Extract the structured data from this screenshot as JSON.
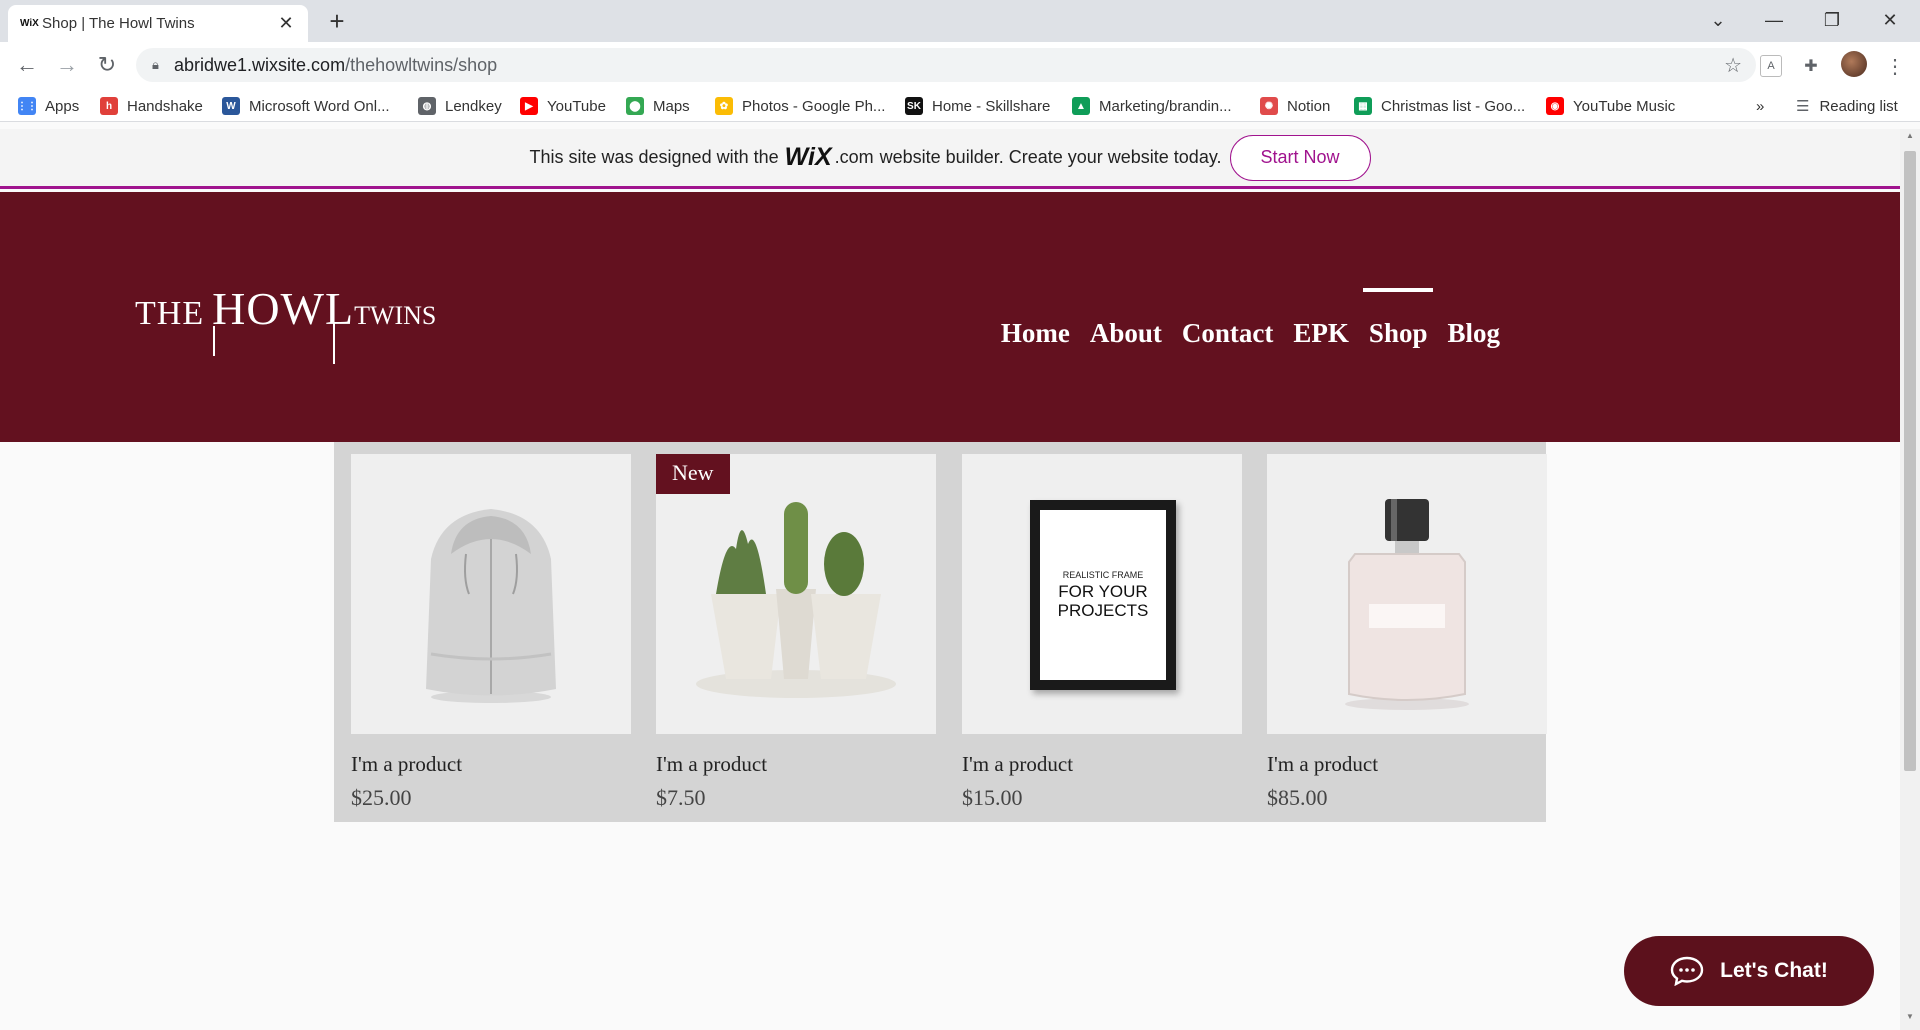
{
  "browser": {
    "tab_title": "Shop | The Howl Twins",
    "tab_favicon": "wix",
    "url_host": "abridwe1.wixsite.com",
    "url_path": "/thehowltwins/shop",
    "bookmarks": [
      {
        "label": "Apps",
        "icon": "apps-grid-icon",
        "color": "#4285f4"
      },
      {
        "label": "Handshake",
        "icon": "handshake-icon",
        "color": "#e0403a"
      },
      {
        "label": "Microsoft Word Onl...",
        "icon": "word-icon",
        "color": "#2b579a"
      },
      {
        "label": "Lendkey",
        "icon": "globe-icon",
        "color": "#5f6368"
      },
      {
        "label": "YouTube",
        "icon": "youtube-icon",
        "color": "#ff0000"
      },
      {
        "label": "Maps",
        "icon": "maps-pin-icon",
        "color": "#34a853"
      },
      {
        "label": "Photos - Google Ph...",
        "icon": "photos-pinwheel-icon",
        "color": "#fbbc05"
      },
      {
        "label": "Home - Skillshare",
        "icon": "skillshare-icon",
        "color": "#111111"
      },
      {
        "label": "Marketing/brandin...",
        "icon": "google-drive-icon",
        "color": "#0f9d58"
      },
      {
        "label": "Notion",
        "icon": "notion-icon",
        "color": "#e04b4b"
      },
      {
        "label": "Christmas list - Goo...",
        "icon": "google-sheets-icon",
        "color": "#0f9d58"
      },
      {
        "label": "YouTube Music",
        "icon": "youtube-music-icon",
        "color": "#ff0000"
      }
    ],
    "overflow_label": "»",
    "reading_list": "Reading list"
  },
  "wix_banner": {
    "message_before": "This site was designed with the",
    "logo": "WiX",
    "logo_suffix": ".com",
    "message_after": "website builder. Create your website today.",
    "button": "Start Now"
  },
  "site": {
    "logo_the": "The",
    "logo_howl": "HowL",
    "logo_twins": "Twins",
    "nav": [
      "Home",
      "About",
      "Contact",
      "EPK",
      "Shop",
      "Blog"
    ],
    "active_nav": "Shop"
  },
  "products": [
    {
      "name": "I'm a product",
      "price": "$25.00",
      "ribbon": "",
      "image": "hoodie"
    },
    {
      "name": "I'm a product",
      "price": "$7.50",
      "ribbon": "New",
      "image": "cactus"
    },
    {
      "name": "I'm a product",
      "price": "$15.00",
      "ribbon": "",
      "image": "frame",
      "frame_text_small": "REALISTIC FRAME",
      "frame_text_large": "FOR YOUR PROJECTS"
    },
    {
      "name": "I'm a product",
      "price": "$85.00",
      "ribbon": "",
      "image": "perfume"
    }
  ],
  "chat": {
    "label": "Let's Chat!"
  },
  "colors": {
    "brand": "#63111f",
    "wix_accent": "#a0138e"
  }
}
